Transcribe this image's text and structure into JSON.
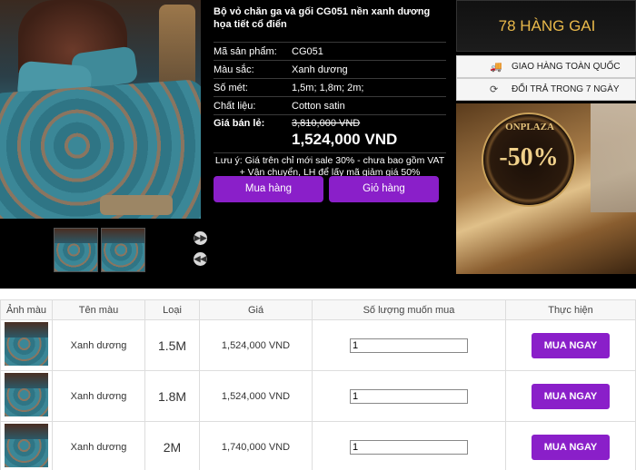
{
  "product": {
    "title": "Bộ vỏ chăn ga và gối CG051 nền xanh dương họa tiết cổ điển",
    "specs": [
      {
        "label": "Mã sản phẩm:",
        "value": "CG051"
      },
      {
        "label": "Màu sắc:",
        "value": "Xanh dương"
      },
      {
        "label": "Số mét:",
        "value": "1,5m; 1,8m; 2m;"
      },
      {
        "label": "Chất liệu:",
        "value": "Cotton satin"
      }
    ],
    "price_label": "Giá bán lẻ:",
    "old_price": "3,810,000 VND",
    "new_price": "1,524,000 VND",
    "note": "Lưu ý: Giá trên chỉ mới sale 30% - chưa bao gồm VAT + Vận chuyển, LH để lấy mã giảm giá 50%",
    "buy_label": "Mua hàng",
    "cart_label": "Giỏ hàng"
  },
  "sidebar": {
    "store_name": "78 HÀNG GAI",
    "services": [
      {
        "icon": "truck-icon",
        "label": "GIAO HÀNG TOÀN QUỐC"
      },
      {
        "icon": "return-icon",
        "label": "ĐỔI TRẢ TRONG 7 NGÀY"
      }
    ],
    "promo": {
      "brand": "ONPLAZA",
      "discount": "-50%"
    }
  },
  "table": {
    "headers": [
      "Ảnh màu",
      "Tên màu",
      "Loại",
      "Giá",
      "Số lượng muốn mua",
      "Thực hiện"
    ],
    "rows": [
      {
        "color": "Xanh dương",
        "type": "1.5M",
        "price": "1,524,000 VND",
        "qty": "1",
        "action": "MUA NGAY"
      },
      {
        "color": "Xanh dương",
        "type": "1.8M",
        "price": "1,524,000 VND",
        "qty": "1",
        "action": "MUA NGAY"
      },
      {
        "color": "Xanh dương",
        "type": "2M",
        "price": "1,740,000 VND",
        "qty": "1",
        "action": "MUA NGAY"
      }
    ]
  },
  "colors": {
    "accent": "#8a1fc9",
    "store_gold": "#e8b84a"
  }
}
